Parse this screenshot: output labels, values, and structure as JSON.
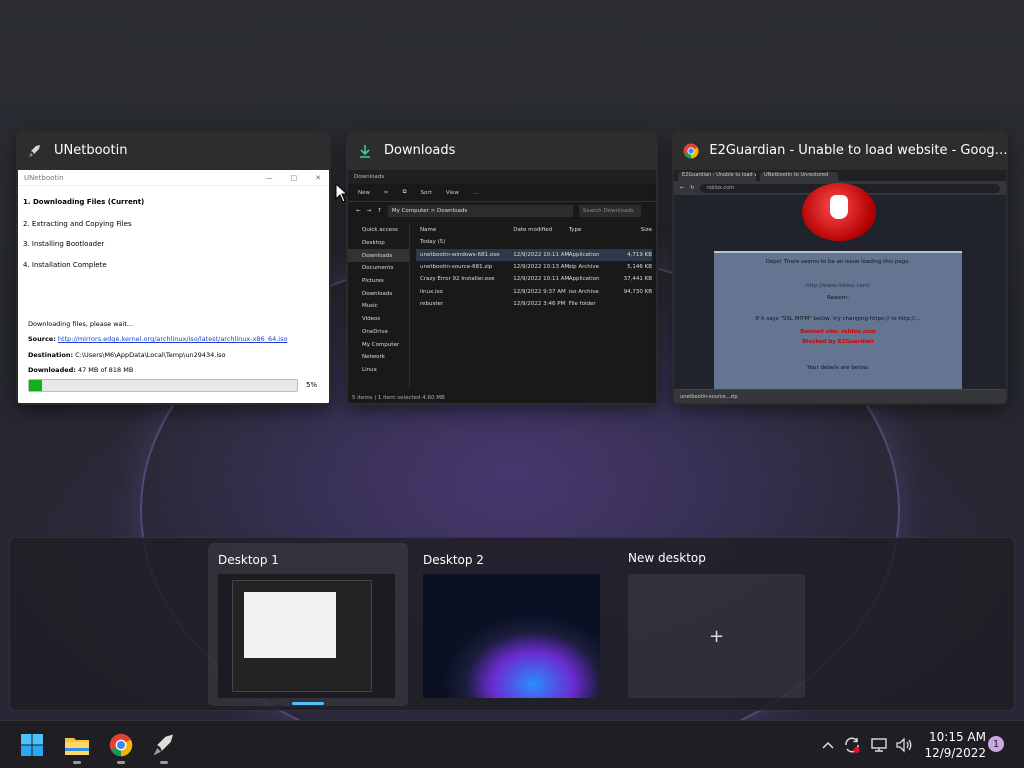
{
  "windows": [
    {
      "title": "UNetbootin",
      "icon": "rocket-icon",
      "body": {
        "app_title": "UNetbootin",
        "steps": [
          "1. Downloading Files (Current)",
          "2. Extracting and Copying Files",
          "3. Installing Bootloader",
          "4. Installation Complete"
        ],
        "status": "Downloading files, please wait...",
        "source_label": "Source:",
        "source_url": "http://mirrors.edge.kernel.org/archlinux/iso/latest/archlinux-x86_64.iso",
        "destination_label": "Destination:",
        "destination_path": "C:\\Users\\M6\\AppData\\Local\\Temp\\un29434.iso",
        "downloaded_label": "Downloaded:",
        "downloaded_value": "47 MB of 818 MB",
        "progress_percent": 5,
        "progress_text": "5%"
      }
    },
    {
      "title": "Downloads",
      "icon": "download-arrow-icon",
      "body": {
        "app_title": "Downloads",
        "toolbar": [
          "New",
          "Sort",
          "View",
          "..."
        ],
        "address": "My Computer  >  Downloads",
        "search_placeholder": "Search Downloads",
        "nav": [
          "Quick access",
          "Desktop",
          "Downloads",
          "Documents",
          "Pictures",
          "Downloads",
          "Music",
          "Videos",
          "OneDrive",
          "My Computer",
          "Network",
          "Linux"
        ],
        "columns": [
          "Name",
          "Date modified",
          "Type",
          "Size"
        ],
        "group": "Today (5)",
        "files": [
          {
            "name": "unetbootin-windows-681.exe",
            "date": "12/9/2022 10:11 AM",
            "type": "Application",
            "size": "4,719 KB"
          },
          {
            "name": "unetbootin-source-681.zip",
            "date": "12/9/2022 10:13 AM",
            "type": "zip Archive",
            "size": "5,146 KB"
          },
          {
            "name": "Crazy Error 92 Installer.exe",
            "date": "12/9/2022 10:11 AM",
            "type": "Application",
            "size": "37,441 KB"
          },
          {
            "name": "linux.iso",
            "date": "12/9/2022 9:37 AM",
            "type": "iso Archive",
            "size": "94,730 KB"
          },
          {
            "name": "rebuster",
            "date": "12/9/2022 3:46 PM",
            "type": "File folder",
            "size": ""
          }
        ],
        "status": "5 items  |  1 item selected  4.60 MB"
      }
    },
    {
      "title": "E2Guardian - Unable to load website - Google...",
      "icon": "chrome-icon",
      "body": {
        "tabs": [
          "E2Guardian - Unable to load w...",
          "UNetbootin to Unrestored"
        ],
        "url": "roblox.com",
        "heading": "Oops! There seems to be an issue loading this page.",
        "line1": "http://www.roblox.com/",
        "line2": "Reason:",
        "line3": "If it says \"SSL MITM\" below, try changing https:// to http://...",
        "red1": "Banned site: roblox.com",
        "red2": "Blocked by E2Guardian",
        "line4": "Your details are below:",
        "download_item": "unetbootin-source...zip"
      }
    }
  ],
  "desktops": [
    {
      "label": "Desktop 1",
      "active": true
    },
    {
      "label": "Desktop 2",
      "active": false
    },
    {
      "label": "New desktop",
      "active": false
    }
  ],
  "taskbar": {
    "apps": [
      "start-icon",
      "file-explorer-icon",
      "chrome-icon",
      "unetbootin-icon"
    ],
    "tray": [
      "chevron-up-icon",
      "sync-icon",
      "network-icon",
      "volume-icon"
    ],
    "time": "10:15 AM",
    "date": "12/9/2022",
    "notification_count": "1"
  },
  "colors": {
    "accent": "#4cc2ff",
    "progress": "#11b11e",
    "error_red": "#d40000"
  }
}
